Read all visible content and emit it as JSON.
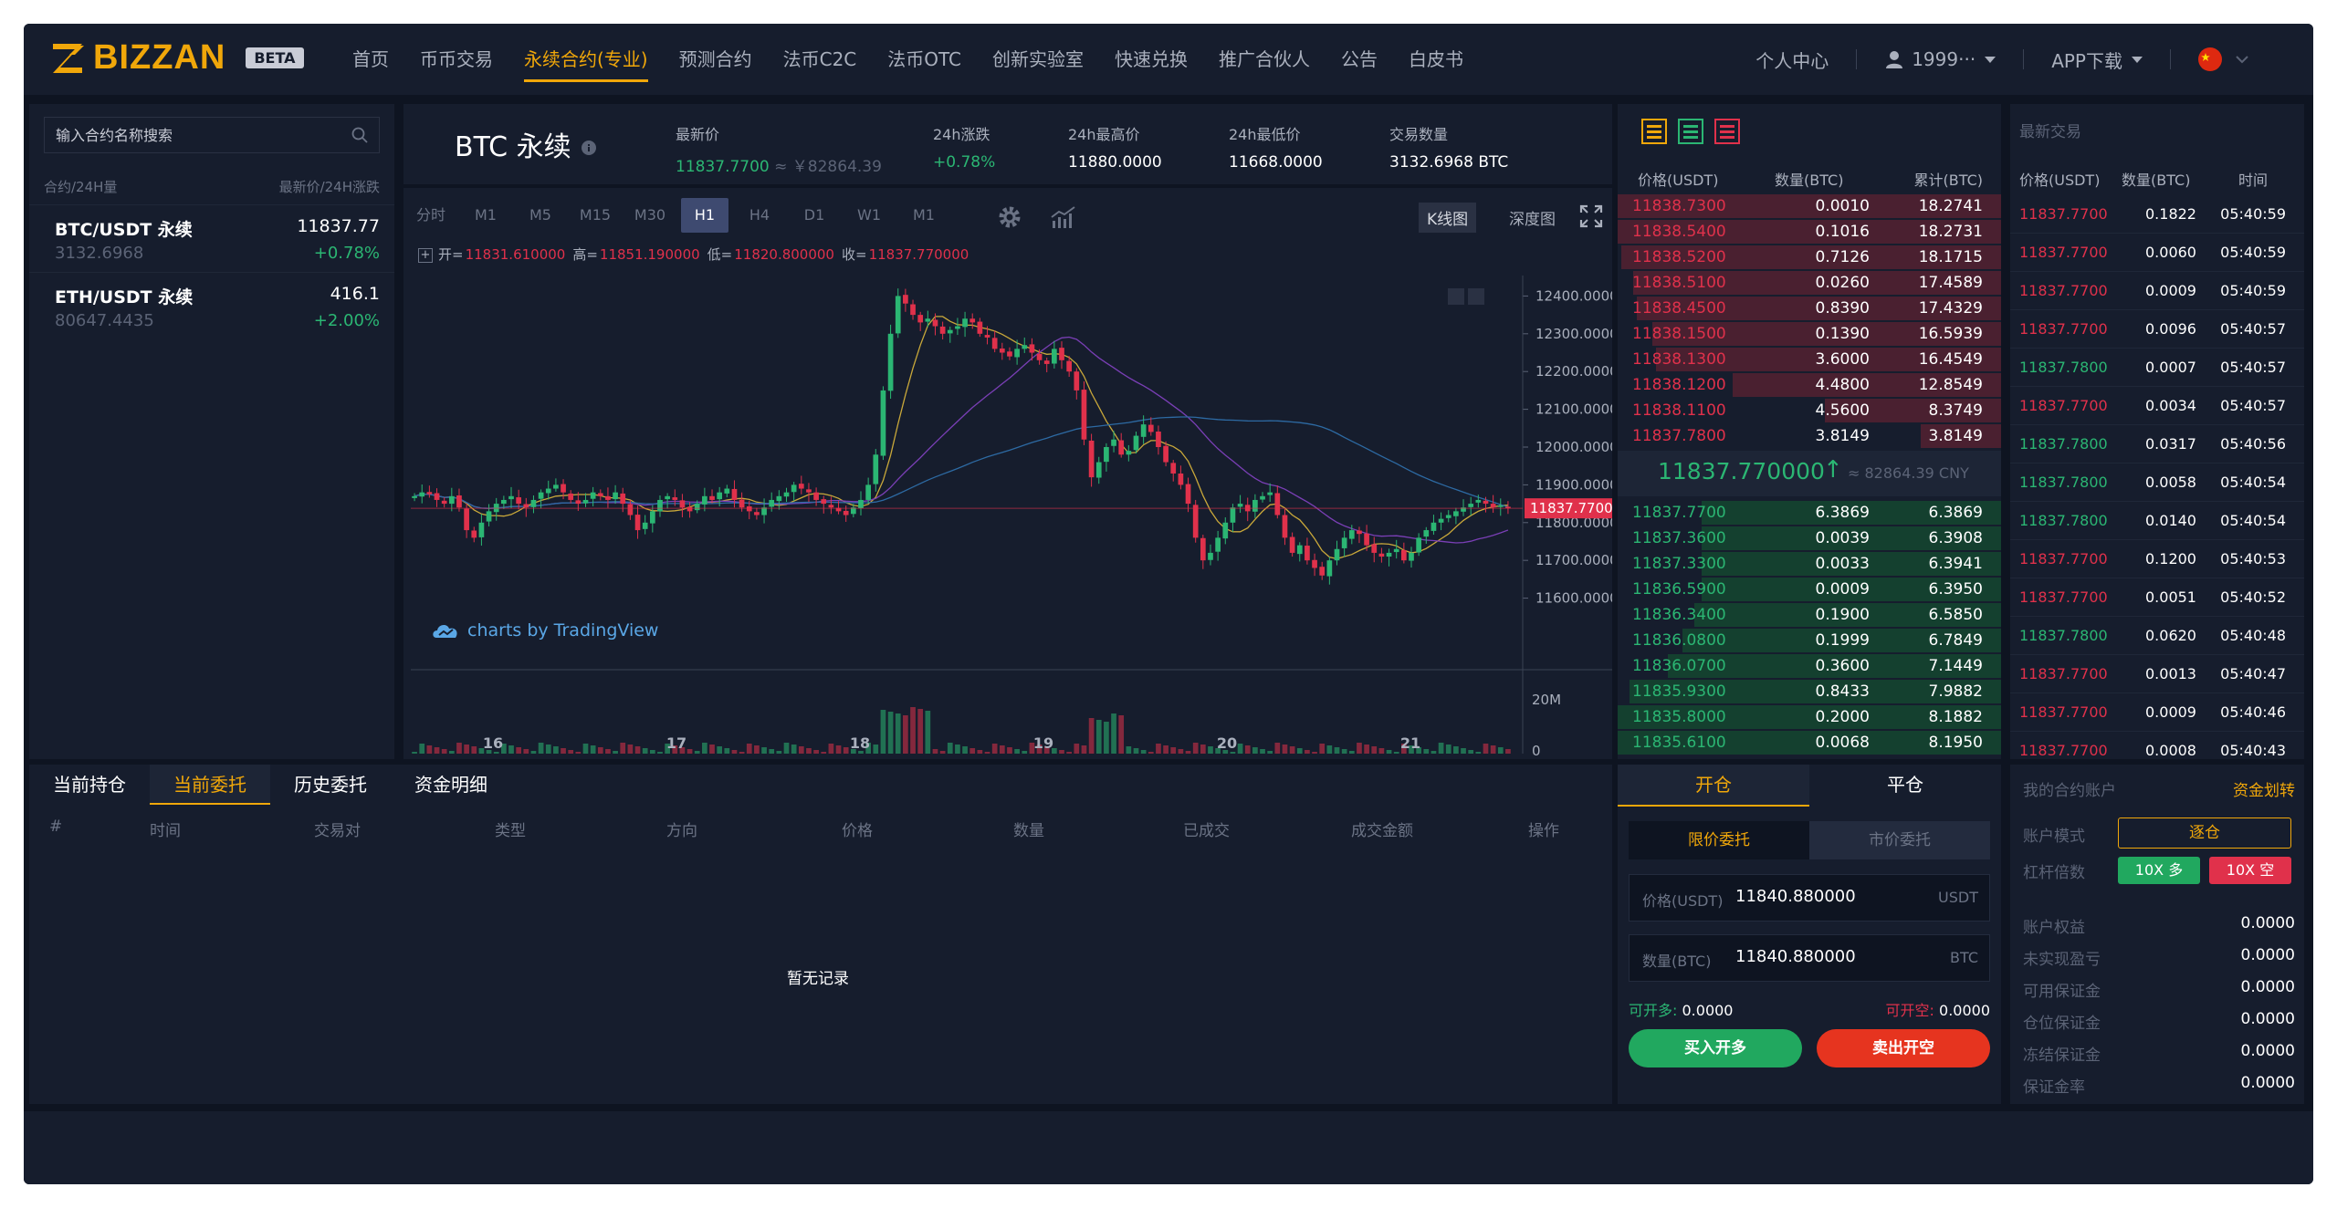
{
  "brand": {
    "logo_text": "BIZZAN",
    "beta": "BETA"
  },
  "nav": {
    "items": [
      "首页",
      "币币交易",
      "永续合约(专业)",
      "预测合约",
      "法币C2C",
      "法币OTC",
      "创新实验室",
      "快速兑换",
      "推广合伙人",
      "公告",
      "白皮书"
    ],
    "active_index": 2,
    "personal_center": "个人中心",
    "user": "1999···",
    "app_download": "APP下载"
  },
  "market": {
    "search_placeholder": "输入合约名称搜索",
    "head_left": "合约/24H量",
    "head_right": "最新价/24H涨跌",
    "rows": [
      {
        "symbol": "BTC/USDT 永续",
        "volume": "3132.6968",
        "price": "11837.77",
        "change": "+0.78%"
      },
      {
        "symbol": "ETH/USDT 永续",
        "volume": "80647.4435",
        "price": "416.1",
        "change": "+2.00%"
      }
    ]
  },
  "ticker": {
    "title": "BTC 永续",
    "last_label": "最新价",
    "last_value": "11837.7700",
    "last_cny": " ≈ ￥82864.39",
    "change_label": "24h涨跌",
    "change_value": "+0.78%",
    "high_label": "24h最高价",
    "high_value": "11880.0000",
    "low_label": "24h最低价",
    "low_value": "11668.0000",
    "volume_label": "交易数量",
    "volume_value": "3132.6968 BTC"
  },
  "chart": {
    "timeframes": [
      "分时",
      "M1",
      "M5",
      "M15",
      "M30",
      "H1",
      "H4",
      "D1",
      "W1",
      "M1"
    ],
    "active_timeframe": 5,
    "tab_kline": "K线图",
    "tab_depth": "深度图",
    "ohlc": {
      "o_label": "开=",
      "o": "11831.610000",
      "h_label": "高=",
      "h": "11851.190000",
      "l_label": "低=",
      "l": "11820.800000",
      "c_label": "收=",
      "c": "11837.770000"
    },
    "watermark": "charts by TradingView",
    "current_price": "11837.770000"
  },
  "chart_data": {
    "type": "candlestick",
    "x_ticks": [
      "16",
      "17",
      "18",
      "19",
      "20",
      "21"
    ],
    "y_ticks": [
      "12400.000000",
      "12300.000000",
      "12200.000000",
      "12100.000000",
      "12000.000000",
      "11900.000000",
      "11800.000000",
      "11700.000000",
      "11600.000000"
    ],
    "ylim": [
      11570,
      12430
    ],
    "volume_ticks": [
      "20M",
      "0"
    ],
    "last_price": 11837.77,
    "close_path": [
      11870,
      11880,
      11875,
      11860,
      11850,
      11870,
      11840,
      11780,
      11760,
      11800,
      11830,
      11850,
      11860,
      11870,
      11850,
      11840,
      11860,
      11880,
      11890,
      11900,
      11880,
      11860,
      11850,
      11860,
      11880,
      11870,
      11860,
      11880,
      11850,
      11820,
      11780,
      11800,
      11830,
      11860,
      11870,
      11860,
      11840,
      11830,
      11850,
      11870,
      11860,
      11880,
      11890,
      11860,
      11840,
      11830,
      11820,
      11840,
      11860,
      11870,
      11880,
      11900,
      11890,
      11880,
      11860,
      11850,
      11840,
      11830,
      11820,
      11840,
      11860,
      11900,
      11980,
      12150,
      12300,
      12400,
      12380,
      12350,
      12330,
      12340,
      12320,
      12300,
      12310,
      12320,
      12340,
      12330,
      12300,
      12290,
      12260,
      12250,
      12240,
      12260,
      12270,
      12250,
      12230,
      12220,
      12260,
      12230,
      12200,
      12150,
      12020,
      11920,
      11960,
      12000,
      12020,
      11980,
      11990,
      12030,
      12060,
      12040,
      12000,
      11960,
      11930,
      11900,
      11850,
      11760,
      11700,
      11720,
      11760,
      11800,
      11840,
      11850,
      11830,
      11860,
      11870,
      11880,
      11820,
      11760,
      11720,
      11740,
      11700,
      11680,
      11660,
      11700,
      11730,
      11760,
      11780,
      11770,
      11740,
      11720,
      11710,
      11720,
      11730,
      11700,
      11720,
      11760,
      11780,
      11800,
      11810,
      11820,
      11830,
      11840,
      11850,
      11860,
      11850,
      11840,
      11845,
      11838
    ]
  },
  "orderbook": {
    "head_price": "价格(USDT)",
    "head_qty": "数量(BTC)",
    "head_total": "累计(BTC)",
    "asks": [
      {
        "price": "11838.7300",
        "qty": "0.0010",
        "total": "18.2741",
        "depth": 1.0
      },
      {
        "price": "11838.5400",
        "qty": "0.1016",
        "total": "18.2731",
        "depth": 1.0
      },
      {
        "price": "11838.5200",
        "qty": "0.7126",
        "total": "18.1715",
        "depth": 0.99
      },
      {
        "price": "11838.5100",
        "qty": "0.0260",
        "total": "17.4589",
        "depth": 0.96
      },
      {
        "price": "11838.4500",
        "qty": "0.8390",
        "total": "17.4329",
        "depth": 0.95
      },
      {
        "price": "11838.1500",
        "qty": "0.1390",
        "total": "16.5939",
        "depth": 0.91
      },
      {
        "price": "11838.1300",
        "qty": "3.6000",
        "total": "16.4549",
        "depth": 0.9
      },
      {
        "price": "11838.1200",
        "qty": "4.4800",
        "total": "12.8549",
        "depth": 0.7
      },
      {
        "price": "11838.1100",
        "qty": "4.5600",
        "total": "8.3749",
        "depth": 0.46
      },
      {
        "price": "11837.7800",
        "qty": "3.8149",
        "total": "3.8149",
        "depth": 0.21
      }
    ],
    "mid_price": "11837.770000",
    "mid_arrow": "↑",
    "mid_cny": "≈ 82864.39 CNY",
    "bids": [
      {
        "price": "11837.7700",
        "qty": "6.3869",
        "total": "6.3869",
        "depth": 0.78
      },
      {
        "price": "11837.3600",
        "qty": "0.0039",
        "total": "6.3908",
        "depth": 0.78
      },
      {
        "price": "11837.3300",
        "qty": "0.0033",
        "total": "6.3941",
        "depth": 0.78
      },
      {
        "price": "11836.5900",
        "qty": "0.0009",
        "total": "6.3950",
        "depth": 0.78
      },
      {
        "price": "11836.3400",
        "qty": "0.1900",
        "total": "6.5850",
        "depth": 0.8
      },
      {
        "price": "11836.0800",
        "qty": "0.1999",
        "total": "6.7849",
        "depth": 0.83
      },
      {
        "price": "11836.0700",
        "qty": "0.3600",
        "total": "7.1449",
        "depth": 0.87
      },
      {
        "price": "11835.9300",
        "qty": "0.8433",
        "total": "7.9882",
        "depth": 0.97
      },
      {
        "price": "11835.8000",
        "qty": "0.2000",
        "total": "8.1882",
        "depth": 1.0
      },
      {
        "price": "11835.6100",
        "qty": "0.0068",
        "total": "8.1950",
        "depth": 1.0
      }
    ]
  },
  "trades": {
    "title": "最新交易",
    "head_price": "价格(USDT)",
    "head_qty": "数量(BTC)",
    "head_time": "时间",
    "rows": [
      {
        "price": "11837.7700",
        "qty": "0.1822",
        "time": "05:40:59",
        "side": "down"
      },
      {
        "price": "11837.7700",
        "qty": "0.0060",
        "time": "05:40:59",
        "side": "down"
      },
      {
        "price": "11837.7700",
        "qty": "0.0009",
        "time": "05:40:59",
        "side": "down"
      },
      {
        "price": "11837.7700",
        "qty": "0.0096",
        "time": "05:40:57",
        "side": "down"
      },
      {
        "price": "11837.7800",
        "qty": "0.0007",
        "time": "05:40:57",
        "side": "up"
      },
      {
        "price": "11837.7700",
        "qty": "0.0034",
        "time": "05:40:57",
        "side": "down"
      },
      {
        "price": "11837.7800",
        "qty": "0.0317",
        "time": "05:40:56",
        "side": "up"
      },
      {
        "price": "11837.7800",
        "qty": "0.0058",
        "time": "05:40:54",
        "side": "up"
      },
      {
        "price": "11837.7800",
        "qty": "0.0140",
        "time": "05:40:54",
        "side": "up"
      },
      {
        "price": "11837.7700",
        "qty": "0.1200",
        "time": "05:40:53",
        "side": "down"
      },
      {
        "price": "11837.7700",
        "qty": "0.0051",
        "time": "05:40:52",
        "side": "down"
      },
      {
        "price": "11837.7800",
        "qty": "0.0620",
        "time": "05:40:48",
        "side": "up"
      },
      {
        "price": "11837.7700",
        "qty": "0.0013",
        "time": "05:40:47",
        "side": "down"
      },
      {
        "price": "11837.7700",
        "qty": "0.0009",
        "time": "05:40:46",
        "side": "down"
      },
      {
        "price": "11837.7700",
        "qty": "0.0008",
        "time": "05:40:43",
        "side": "down"
      }
    ]
  },
  "orders": {
    "tabs": [
      "当前持仓",
      "当前委托",
      "历史委托",
      "资金明细"
    ],
    "active_tab": 1,
    "columns": [
      "#",
      "时间",
      "交易对",
      "类型",
      "方向",
      "价格",
      "数量",
      "已成交",
      "成交金额",
      "操作"
    ],
    "empty": "暂无记录"
  },
  "trade_form": {
    "tab_open": "开仓",
    "tab_close": "平仓",
    "limit": "限价委托",
    "market": "市价委托",
    "price_label": "价格(USDT)",
    "price_value": "11840.880000",
    "price_unit": "USDT",
    "qty_label": "数量(BTC)",
    "qty_value": "11840.880000",
    "qty_unit": "BTC",
    "avail_long_label": "可开多:",
    "avail_long": "0.0000",
    "avail_short_label": "可开空:",
    "avail_short": "0.0000",
    "buy_btn": "买入开多",
    "sell_btn": "卖出开空"
  },
  "account": {
    "title": "我的合约账户",
    "transfer": "资金划转",
    "mode_label": "账户模式",
    "mode_value": "逐仓",
    "leverage_label": "杠杆倍数",
    "lev_long": "10X 多",
    "lev_short": "10X 空",
    "rows": [
      {
        "k": "账户权益",
        "v": "0.0000"
      },
      {
        "k": "未实现盈亏",
        "v": "0.0000"
      },
      {
        "k": "可用保证金",
        "v": "0.0000"
      },
      {
        "k": "仓位保证金",
        "v": "0.0000"
      },
      {
        "k": "冻结保证金",
        "v": "0.0000"
      },
      {
        "k": "保证金率",
        "v": "0.0000"
      }
    ]
  },
  "colors": {
    "accent": "#f0a70a",
    "up": "#2bb673",
    "down": "#e0314b",
    "bg": "#0e1421",
    "panel": "#161d2d"
  }
}
